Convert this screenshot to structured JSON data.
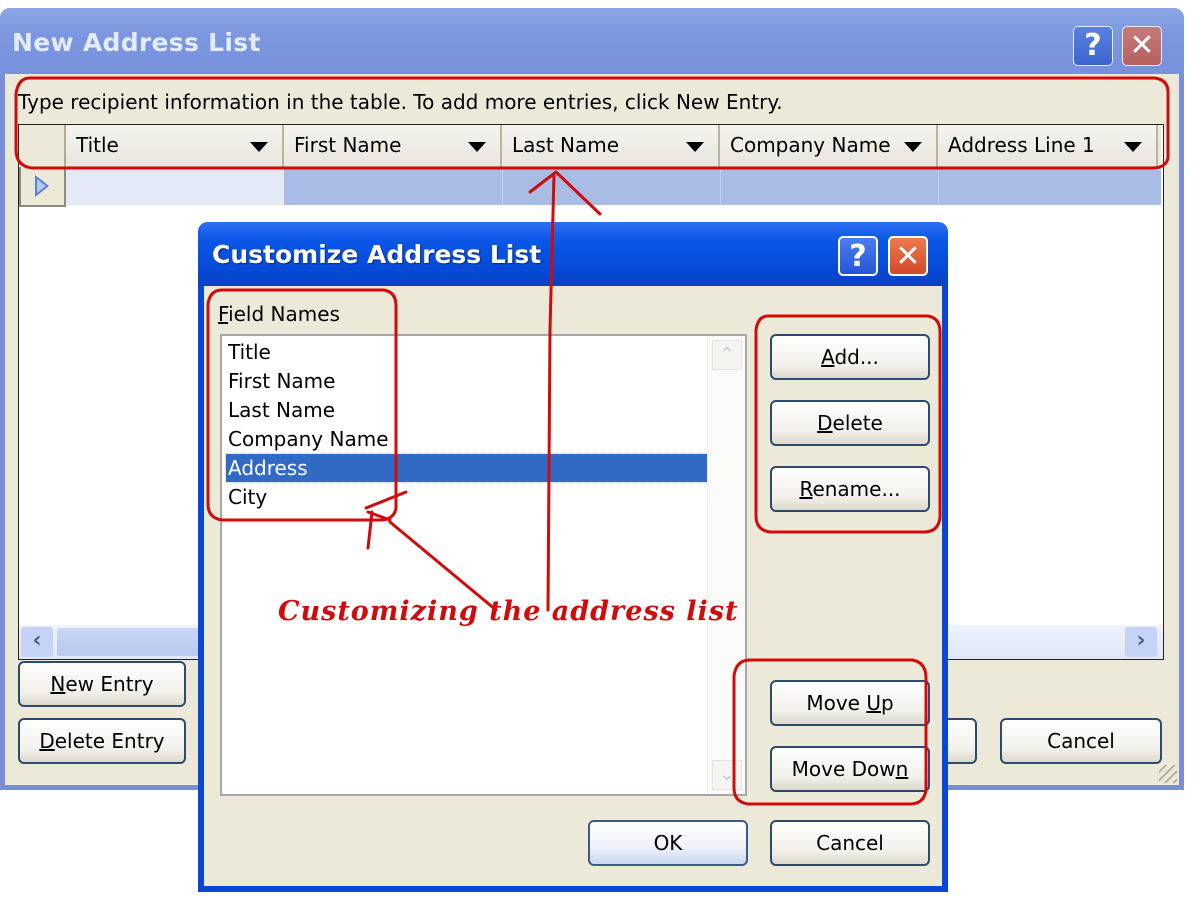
{
  "outer_dialog": {
    "title": "New Address List",
    "help_label": "?",
    "close_label": "✕",
    "instructions": "Type recipient information in the table.  To add more entries, click New Entry.",
    "columns": [
      "Title",
      "First Name",
      "Last Name",
      "Company Name",
      "Address Line 1"
    ],
    "scroll_left": "‹",
    "scroll_right": "›",
    "buttons": {
      "new_entry": {
        "mnemonic": "N",
        "rest": "ew Entry"
      },
      "delete_entry": {
        "mnemonic": "D",
        "rest": "elete Entry"
      },
      "cancel": "Cancel"
    }
  },
  "inner_dialog": {
    "title": "Customize Address List",
    "help_label": "?",
    "close_label": "✕",
    "field_names_label": {
      "mnemonic": "F",
      "rest": "ield Names"
    },
    "fields": [
      {
        "name": "Title",
        "selected": false
      },
      {
        "name": "First Name",
        "selected": false
      },
      {
        "name": "Last Name",
        "selected": false
      },
      {
        "name": "Company Name",
        "selected": false
      },
      {
        "name": "Address",
        "selected": true
      },
      {
        "name": "City",
        "selected": false
      }
    ],
    "scroll_up": "⌃",
    "scroll_down": "⌄",
    "buttons": {
      "add": {
        "mnemonic": "A",
        "rest": "dd..."
      },
      "delete": {
        "mnemonic": "D",
        "rest": "elete"
      },
      "rename": {
        "mnemonic": "R",
        "rest": "ename..."
      },
      "move_up": {
        "pre": "Move ",
        "mnemonic": "U",
        "rest": "p"
      },
      "move_down": {
        "pre": "Move Dow",
        "mnemonic": "n",
        "rest": ""
      },
      "ok": "OK",
      "cancel": "Cancel"
    }
  },
  "annotation": {
    "text": "Customizing the address list",
    "color": "#d10a0a"
  },
  "colors": {
    "outer_title_bar": "#7c97e0",
    "inner_title_bar": "#0a56e6",
    "dialog_face": "#ece9d8",
    "selection": "#316ac5"
  }
}
